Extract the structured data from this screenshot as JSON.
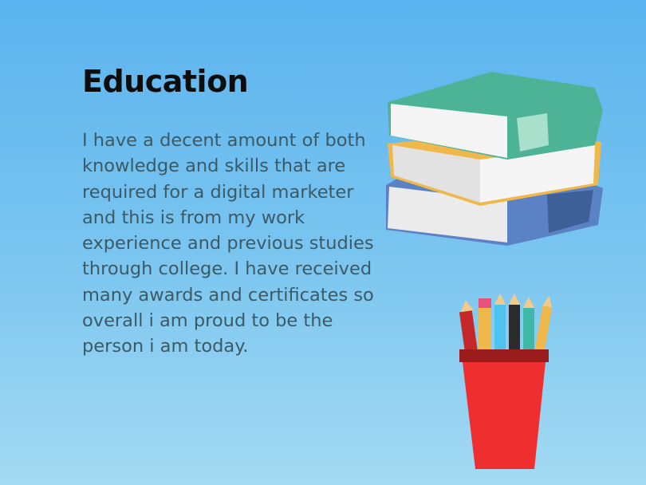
{
  "slide": {
    "title": "Education",
    "body": "I have a decent amount of both knowledge and skills that are required for a digital marketer and this is from my work experience and previous studies through college. I have received many awards and certificates so overall i am proud to be the person i am today."
  },
  "illustrations": {
    "books_icon": "stack-of-books",
    "pencil_cup_icon": "pencil-cup"
  },
  "colors": {
    "background_top": "#5ab3ee",
    "background_bottom": "#a4daf2",
    "book_green": "#4db396",
    "book_yellow": "#f0b84a",
    "book_blue": "#5b82c4",
    "cup_red": "#ef2f2f"
  }
}
